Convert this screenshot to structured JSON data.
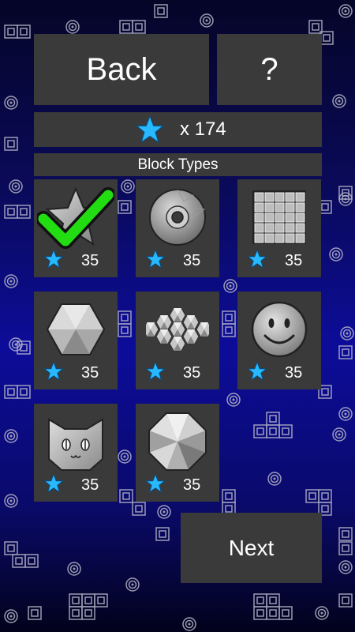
{
  "header": {
    "back_label": "Back",
    "help_label": "?"
  },
  "stars": {
    "count_text": "x 174",
    "icon": "star-icon",
    "color": "#27b8ff"
  },
  "section": {
    "title": "Block Types"
  },
  "blocks": [
    {
      "icon": "star-block-icon",
      "cost": "35",
      "unlocked": true
    },
    {
      "icon": "donut-block-icon",
      "cost": "35"
    },
    {
      "icon": "grid-block-icon",
      "cost": "35"
    },
    {
      "icon": "hexagon-block-icon",
      "cost": "35"
    },
    {
      "icon": "hex-cluster-block-icon",
      "cost": "35"
    },
    {
      "icon": "smiley-block-icon",
      "cost": "35"
    },
    {
      "icon": "cat-block-icon",
      "cost": "35"
    },
    {
      "icon": "octagon-block-icon",
      "cost": "35"
    }
  ],
  "footer": {
    "next_label": "Next"
  },
  "colors": {
    "panel": "#3a3a3a",
    "check": "#22dd11",
    "star": "#27b8ff"
  }
}
